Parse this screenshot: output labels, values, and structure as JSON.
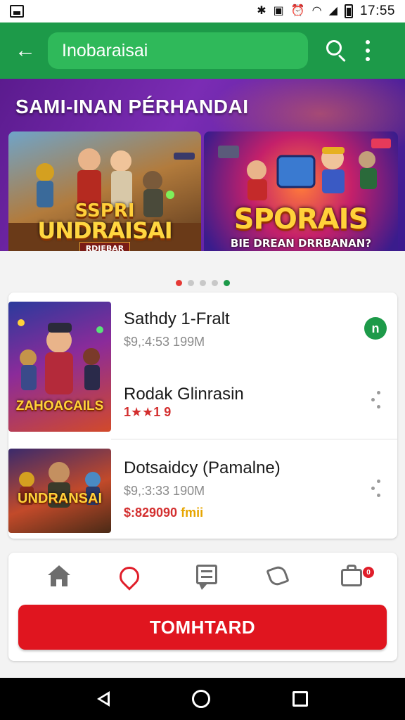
{
  "status_bar": {
    "time": "17:55",
    "icons": [
      "image-icon",
      "bluetooth-icon",
      "vibrate-icon",
      "alarm-icon",
      "wifi-icon",
      "signal-icon",
      "battery-icon"
    ]
  },
  "app_bar": {
    "title": "Inobaraisai",
    "accent_color": "#1d9a49"
  },
  "promo": {
    "heading": "SAMI-INAN PÉRHANDAI",
    "banners": [
      {
        "logo_top": "SSPRI",
        "logo_main": "UNDRAISAI",
        "logo_sub": "RDIEBAR"
      },
      {
        "logo_main": "SPORAIS",
        "logo_sub": "BIE DREAN DRRBANAN?"
      }
    ],
    "carousel_dots": 5,
    "active_dot_color": "#e53935"
  },
  "list": {
    "items": [
      {
        "title": "Sathdy 1-Fralt",
        "subtitle": "$9,:4:53 199M",
        "badge": "n"
      },
      {
        "title": "Rodak Glinrasin",
        "rating": "1★★1 9"
      },
      {
        "title": "Dotsaidcy (Pamalne)",
        "subtitle": "$9,:3:33 190M",
        "price": "$:829090",
        "price_suffix": "fmii"
      }
    ],
    "thumb_logos": [
      "ZAHOACAILS",
      "UNDRANSAI"
    ]
  },
  "bottom_bar": {
    "nav_icons": [
      "home-icon",
      "heart-icon",
      "chat-icon",
      "share-icon",
      "bag-icon"
    ],
    "cart_badge": "0",
    "cta_label": "TOMHTARD",
    "cta_color": "#e0151f"
  }
}
